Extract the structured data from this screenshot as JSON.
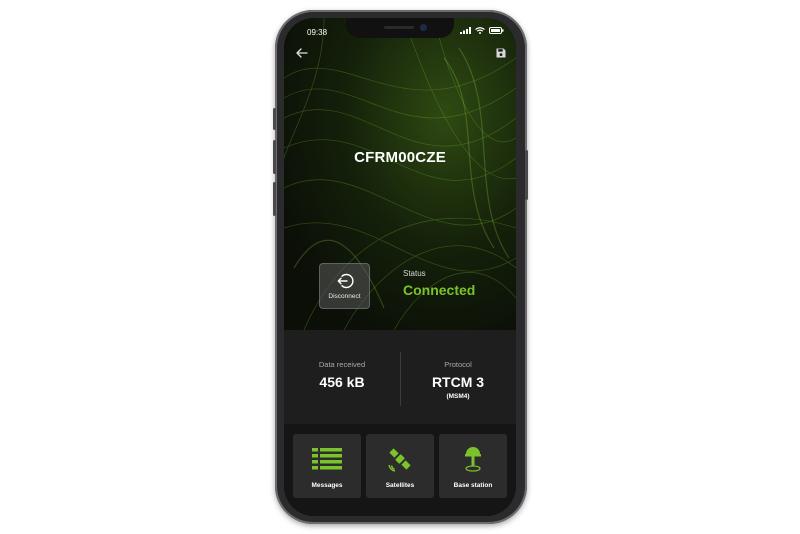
{
  "status_bar": {
    "time": "09:38"
  },
  "icons": {
    "back": "arrow-left-icon",
    "save": "floppy-disk-icon",
    "disconnect": "logout-circle-icon",
    "messages": "list-icon",
    "satellites": "satellite-icon",
    "base_station": "antenna-icon"
  },
  "device": {
    "name": "CFRM00CZE"
  },
  "connection": {
    "disconnect_label": "Disconnect",
    "status_label": "Status",
    "status_value": "Connected"
  },
  "stats": {
    "data_received_label": "Data received",
    "data_received_value": "456 kB",
    "protocol_label": "Protocol",
    "protocol_value": "RTCM 3",
    "protocol_sub": "(MSM4)"
  },
  "tiles": [
    {
      "label": "Messages"
    },
    {
      "label": "Satellites"
    },
    {
      "label": "Base station"
    }
  ],
  "colors": {
    "accent": "#7bc32a",
    "background": "#121212",
    "tile": "#2c2c2c"
  }
}
